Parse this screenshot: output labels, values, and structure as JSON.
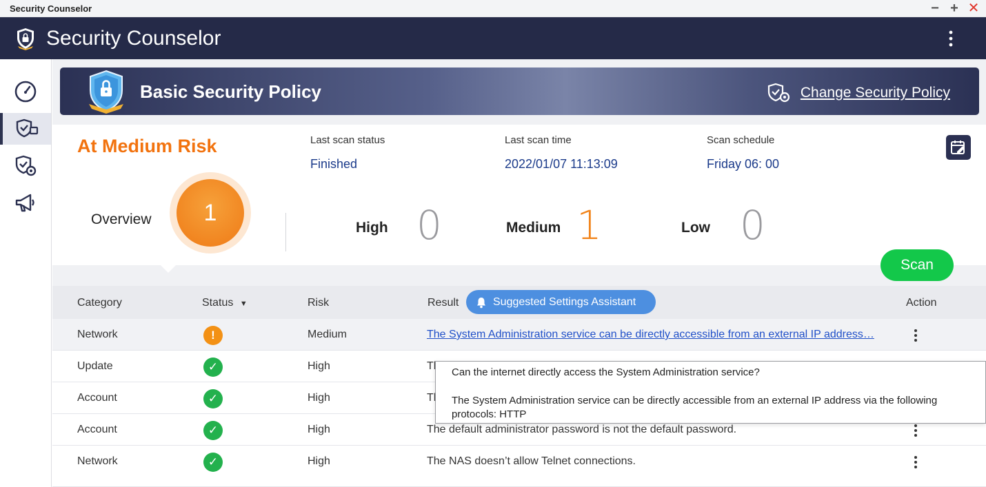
{
  "window": {
    "title": "Security Counselor",
    "minimize": "−",
    "maximize": "+",
    "close": "✕"
  },
  "app": {
    "title": "Security Counselor"
  },
  "sidebar": {
    "items": [
      {
        "name": "overview",
        "icon": "gauge-icon"
      },
      {
        "name": "security-checkup",
        "icon": "shield-check-icon",
        "active": true
      },
      {
        "name": "settings",
        "icon": "shield-gear-icon"
      },
      {
        "name": "announcements",
        "icon": "megaphone-icon"
      }
    ]
  },
  "policy": {
    "title": "Basic Security Policy",
    "change_link": "Change Security Policy"
  },
  "overview": {
    "risk_title": "At Medium Risk",
    "last_scan_status_label": "Last scan status",
    "last_scan_status": "Finished",
    "last_scan_time_label": "Last scan time",
    "last_scan_time": "2022/01/07 11:13:09",
    "schedule_label": "Scan schedule",
    "schedule": "Friday 06: 00",
    "overview_label": "Overview",
    "total": "1",
    "high_label": "High",
    "high_count": "0",
    "medium_label": "Medium",
    "medium_count": "1",
    "low_label": "Low",
    "low_count": "0",
    "scan_button": "Scan"
  },
  "table": {
    "headers": {
      "category": "Category",
      "status": "Status",
      "status_sort": "▼",
      "risk": "Risk",
      "result": "Result",
      "action": "Action"
    },
    "assistant_button": "Suggested Settings Assistant",
    "rows": [
      {
        "category": "Network",
        "status": "warning",
        "status_glyph": "!",
        "risk": "Medium",
        "result": "The System Administration service can be directly accessible from an external IP address…"
      },
      {
        "category": "Update",
        "status": "ok",
        "status_glyph": "✓",
        "risk": "High",
        "result": "Th"
      },
      {
        "category": "Account",
        "status": "ok",
        "status_glyph": "✓",
        "risk": "High",
        "result": "Th"
      },
      {
        "category": "Account",
        "status": "ok",
        "status_glyph": "✓",
        "risk": "High",
        "result": "The default administrator password is not the default password."
      },
      {
        "category": "Network",
        "status": "ok",
        "status_glyph": "✓",
        "risk": "High",
        "result": "The NAS doesn’t allow Telnet connections."
      }
    ]
  },
  "tooltip": {
    "question": "Can the internet directly access the System Administration service?",
    "answer": "The System Administration service can be directly accessible from an external IP address via the following protocols: HTTP"
  }
}
